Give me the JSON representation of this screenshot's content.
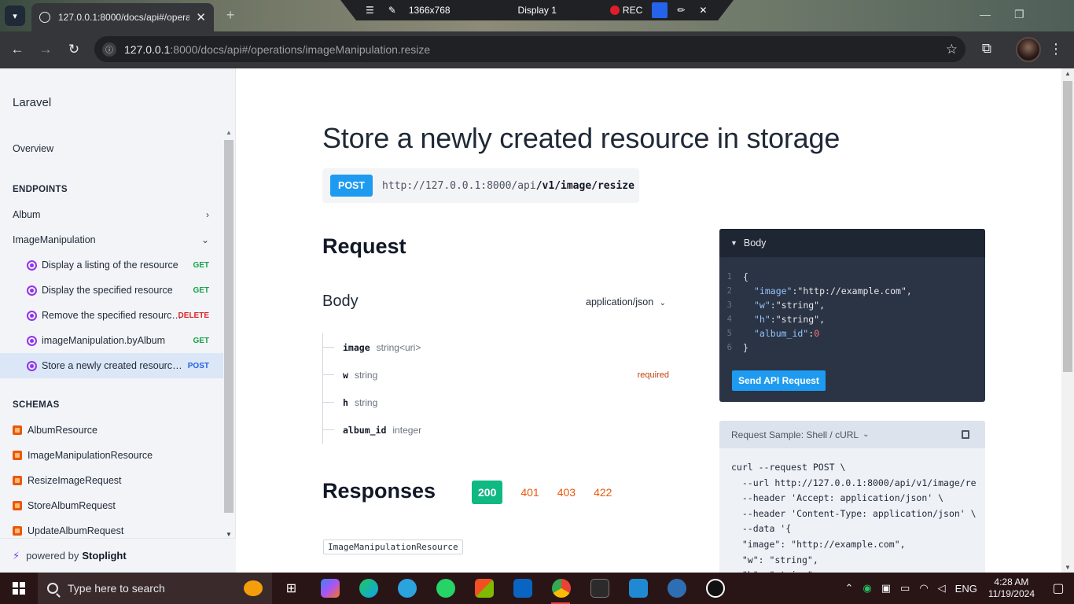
{
  "browser": {
    "tab_title": "127.0.0.1:8000/docs/api#/opera",
    "url_host": "127.0.0.1",
    "url_path": ":8000/docs/api#/operations/imageManipulation.resize",
    "new_tab": "+",
    "tab_close": "✕"
  },
  "recorder": {
    "resolution": "1366x768",
    "display": "Display 1",
    "rec": "REC"
  },
  "sidebar": {
    "brand": "Laravel",
    "overview": "Overview",
    "endpoints_title": "ENDPOINTS",
    "groups": [
      {
        "label": "Album",
        "expanded": false
      },
      {
        "label": "ImageManipulation",
        "expanded": true
      }
    ],
    "endpoints": [
      {
        "label": "Display a listing of the resource",
        "method": "GET"
      },
      {
        "label": "Display the specified resource",
        "method": "GET"
      },
      {
        "label": "Remove the specified resource ...",
        "method": "DELETE"
      },
      {
        "label": "imageManipulation.byAlbum",
        "method": "GET"
      },
      {
        "label": "Store a newly created resource in...",
        "method": "POST"
      }
    ],
    "schemas_title": "SCHEMAS",
    "schemas": [
      "AlbumResource",
      "ImageManipulationResource",
      "ResizeImageRequest",
      "StoreAlbumRequest",
      "UpdateAlbumRequest"
    ],
    "powered_by": "powered by",
    "powered_brand": "Stoplight"
  },
  "main": {
    "title": "Store a newly created resource in storage",
    "method": "POST",
    "base_url": "http://127.0.0.1:8000/api",
    "path": "/v1/image/resize",
    "request_heading": "Request",
    "body_heading": "Body",
    "content_type": "application/json",
    "params": [
      {
        "name": "image",
        "type": "string<uri>",
        "required": ""
      },
      {
        "name": "w",
        "type": "string",
        "required": "required"
      },
      {
        "name": "h",
        "type": "string",
        "required": ""
      },
      {
        "name": "album_id",
        "type": "integer",
        "required": ""
      }
    ],
    "responses_heading": "Responses",
    "response_codes": [
      "200",
      "401",
      "403",
      "422"
    ],
    "response_schema": "ImageManipulationResource"
  },
  "body_panel": {
    "header": "Body",
    "lines": [
      {
        "num": "1",
        "text": "{"
      },
      {
        "num": "2",
        "key": "\"image\"",
        "value": "\"http://example.com\"",
        "tail": ","
      },
      {
        "num": "3",
        "key": "\"w\"",
        "value": "\"string\"",
        "tail": ","
      },
      {
        "num": "4",
        "key": "\"h\"",
        "value": "\"string\"",
        "tail": ","
      },
      {
        "num": "5",
        "key": "\"album_id\"",
        "value": "0",
        "tail": ""
      },
      {
        "num": "6",
        "text": "}"
      }
    ],
    "send_button": "Send API Request"
  },
  "sample_panel": {
    "header": "Request Sample: Shell / cURL",
    "code": "curl --request POST \\\n  --url http://127.0.0.1:8000/api/v1/image/re\n  --header 'Accept: application/json' \\\n  --header 'Content-Type: application/json' \\\n  --data '{\n  \"image\": \"http://example.com\",\n  \"w\": \"string\",\n  \"h\": \"string\","
  },
  "taskbar": {
    "search_placeholder": "Type here to search",
    "lang": "ENG",
    "time": "4:28 AM",
    "date": "11/19/2024"
  },
  "colors": {
    "accent_blue": "#1e9bf0",
    "get": "#16a34a",
    "delete": "#dc2626",
    "post": "#2563eb",
    "success": "#10b981",
    "error_code": "#ea580c"
  }
}
